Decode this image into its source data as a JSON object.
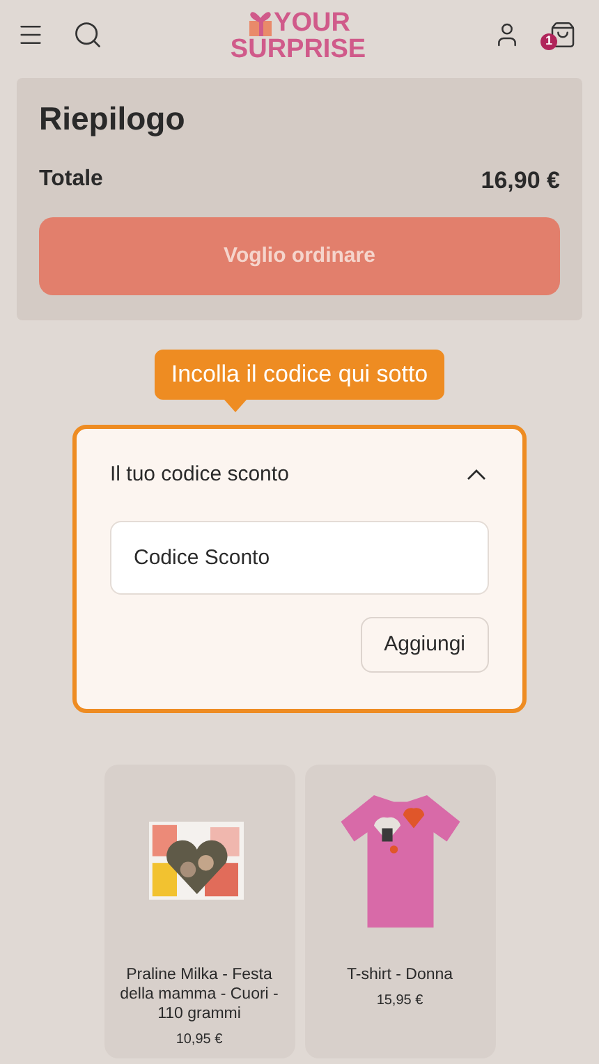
{
  "header": {
    "logo_top": "YOUR",
    "logo_bottom": "SURPRISE",
    "cart_count": "1"
  },
  "summary": {
    "title": "Riepilogo",
    "total_label": "Totale",
    "total_value": "16,90 €",
    "order_button": "Voglio ordinare",
    "order_disabled": true
  },
  "tooltip": "Incolla il codice qui sotto",
  "coupon": {
    "title": "Il tuo codice sconto",
    "expanded": true,
    "placeholder": "Codice Sconto",
    "add_button": "Aggiungi"
  },
  "products": [
    {
      "kind": "picture",
      "name": "Praline Milka - Festa della mamma - Cuori - 110 grammi",
      "price": "10,95 €"
    },
    {
      "kind": "picture",
      "name": "T-shirt - Donna",
      "price": "15,95 €"
    }
  ]
}
